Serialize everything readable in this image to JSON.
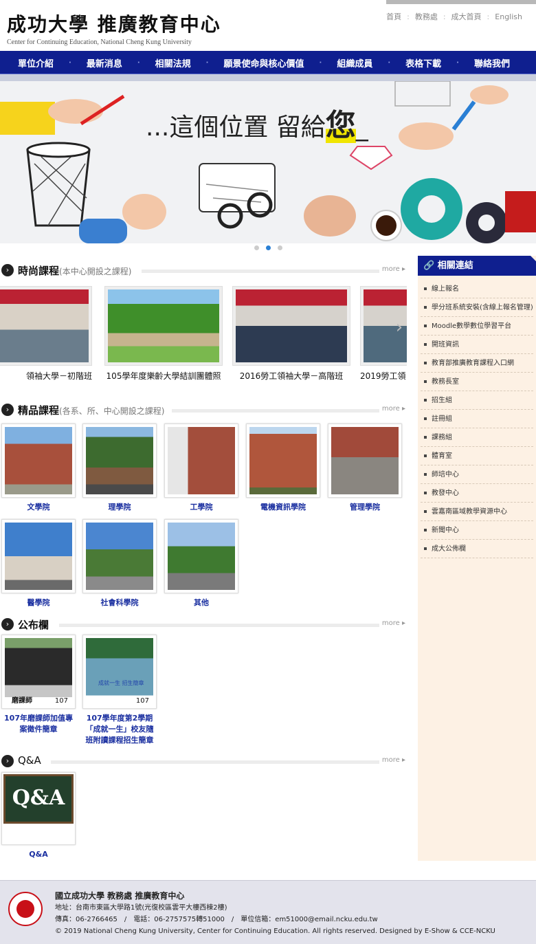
{
  "header": {
    "logo_cn": "成功大學 推廣教育中心",
    "logo_en": "Center for Continuing Education, National Cheng Kung University",
    "links": [
      "首頁",
      "教務處",
      "成大首頁",
      "English"
    ]
  },
  "nav": [
    "單位介紹",
    "最新消息",
    "相關法規",
    "願景使命與核心價值",
    "組織成員",
    "表格下載",
    "聯絡我們"
  ],
  "banner": {
    "text_prefix": "...這個位置 留給",
    "text_big": "您",
    "text_suffix": "_"
  },
  "sections": {
    "fashion": {
      "title": "時尚課程",
      "subtitle": "(本中心開設之課程)",
      "more": "more"
    },
    "premium": {
      "title": "精品課程",
      "subtitle": "(各系、所、中心開設之課程)",
      "more": "more"
    },
    "bulletin": {
      "title": "公布欄",
      "more": "more"
    },
    "qa": {
      "title": "Q&A",
      "more": "more"
    }
  },
  "carousel": [
    "領袖大學－初階班",
    "105學年度樂齡大學結訓團體照",
    "2016勞工領袖大學－高階班",
    "2019勞工領"
  ],
  "colleges": [
    "文學院",
    "理學院",
    "工學院",
    "電機資訊學院",
    "管理學院",
    "醫學院",
    "社會科學院",
    "其他"
  ],
  "bulletin": [
    {
      "caption": "107年磨課師加值專案徵件簡章",
      "tag": "磨課師",
      "num": "107"
    },
    {
      "caption": "107學年度第2學期「成就一生」校友隨班附讀課程招生簡章",
      "tag": "成就一生 招生簡章",
      "num": "107"
    }
  ],
  "qa": {
    "caption": "Q&A",
    "board": "Q&A"
  },
  "sidebar": {
    "title": "相關連結",
    "items": [
      "線上報名",
      "學分班系統安裝(含線上報名管理)",
      "Moodle數學數位學習平台",
      "開班資訊",
      "教育部推廣教育課程入口網",
      "教務長室",
      "招生組",
      "註冊組",
      "課務組",
      "體育室",
      "師培中心",
      "教發中心",
      "雲嘉南區域教學資源中心",
      "新聞中心",
      "成大公佈欄"
    ]
  },
  "footer": {
    "line1": "國立成功大學 教務處 推廣教育中心",
    "line2": "地址：台南市東區大學路1號(光復校區雲平大樓西棟2樓)",
    "line3": "傳真：06-2766465　/　電話：06-2757575轉51000　/　單位信箱：em51000@email.ncku.edu.tw",
    "line4": "© 2019 National Cheng Kung University, Center for Continuing Education. All rights reserved. Designed by E-Show & CCE-NCKU"
  },
  "colors": {
    "nav": "#0f1f8f",
    "sidebar_bg": "#fdf1e4",
    "link_blue": "#1a2fa0"
  }
}
